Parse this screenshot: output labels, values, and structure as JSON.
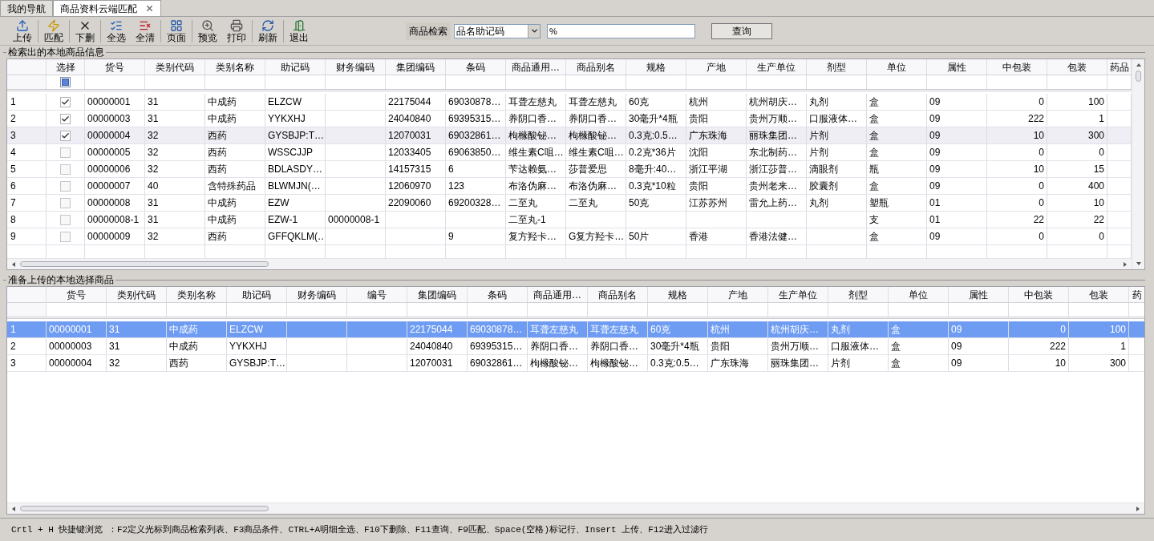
{
  "tabs": [
    {
      "label": "我的导航",
      "selected": false,
      "closable": false
    },
    {
      "label": "商品资料云端匹配",
      "selected": true,
      "closable": true
    }
  ],
  "toolbar": [
    {
      "label": "上传",
      "separator_after": true
    },
    {
      "label": "匹配",
      "separator_after": true
    },
    {
      "label": "下删",
      "separator_after": true
    },
    {
      "label": "全选",
      "separator_after": false
    },
    {
      "label": "全清",
      "separator_after": true
    },
    {
      "label": "页面",
      "separator_after": true
    },
    {
      "label": "预览",
      "separator_after": false
    },
    {
      "label": "打印",
      "separator_after": true
    },
    {
      "label": "刷新",
      "separator_after": true
    },
    {
      "label": "退出",
      "separator_after": false
    }
  ],
  "search": {
    "label": "商品检索",
    "field": "品名助记码",
    "value": "%",
    "button": "查询"
  },
  "local_goods": {
    "title": "检索出的本地商品信息",
    "check_column": "选择",
    "select_all_partial": true,
    "columns": [
      {
        "label": "货号",
        "kind": "text"
      },
      {
        "label": "类别代码",
        "kind": "text"
      },
      {
        "label": "类别名称",
        "kind": "text"
      },
      {
        "label": "助记码",
        "kind": "text"
      },
      {
        "label": "财务编码",
        "kind": "text"
      },
      {
        "label": "集团编码",
        "kind": "text"
      },
      {
        "label": "条码",
        "kind": "text"
      },
      {
        "label": "商品通用…",
        "kind": "text"
      },
      {
        "label": "商品别名",
        "kind": "text"
      },
      {
        "label": "规格",
        "kind": "text"
      },
      {
        "label": "产地",
        "kind": "text"
      },
      {
        "label": "生产单位",
        "kind": "text"
      },
      {
        "label": "剂型",
        "kind": "text"
      },
      {
        "label": "单位",
        "kind": "text"
      },
      {
        "label": "属性",
        "kind": "text"
      },
      {
        "label": "中包装",
        "kind": "number"
      },
      {
        "label": "包装",
        "kind": "number"
      },
      {
        "label": "药品",
        "kind": "text"
      }
    ],
    "rows": [
      {
        "no": "1",
        "checked": true,
        "selected": false,
        "cells": [
          "00000001",
          "31",
          "中成药",
          "ELZCW",
          null,
          "22175044",
          "69030878…",
          "耳聋左慈丸",
          "耳聋左慈丸",
          "60克",
          "杭州",
          "杭州胡庆…",
          "丸剂",
          "盒",
          "09",
          "0",
          "100"
        ]
      },
      {
        "no": "2",
        "checked": true,
        "selected": false,
        "cells": [
          "00000003",
          "31",
          "中成药",
          "YYKXHJ",
          null,
          "24040840",
          "69395315…",
          "养阴口香…",
          "养阴口香…",
          "30毫升*4瓶",
          "贵阳",
          "贵州万顺…",
          "口服液体…",
          "盒",
          "09",
          "222",
          "1"
        ]
      },
      {
        "no": "3",
        "checked": true,
        "selected": true,
        "cells": [
          "00000004",
          "32",
          "西药",
          "GYSBJP:T…",
          null,
          "12070031",
          "69032861…",
          "枸橼酸铋…",
          "枸橼酸铋…",
          "0.3克:0.5…",
          "广东珠海",
          "丽珠集团…",
          "片剂",
          "盒",
          "09",
          "10",
          "300"
        ]
      },
      {
        "no": "4",
        "checked": false,
        "selected": false,
        "cells": [
          "00000005",
          "32",
          "西药",
          "WSSCJJP",
          null,
          "12033405",
          "69063850…",
          "维生素C咀…",
          "维生素C咀…",
          "0.2克*36片",
          "沈阳",
          "东北制药…",
          "片剂",
          "盒",
          "09",
          "0",
          "0"
        ]
      },
      {
        "no": "5",
        "checked": false,
        "selected": false,
        "cells": [
          "00000006",
          "32",
          "西药",
          "BDLASDY…",
          null,
          "14157315",
          "6",
          "苄达赖氨…",
          "莎普爱思",
          "8毫升:40…",
          "浙江平湖",
          "浙江莎普…",
          "滴眼剂",
          "瓶",
          "09",
          "10",
          "15"
        ]
      },
      {
        "no": "6",
        "checked": false,
        "selected": false,
        "cells": [
          "00000007",
          "40",
          "含特殊药品",
          "BLWMJN(…",
          null,
          "12060970",
          "123",
          "布洛伪麻…",
          "布洛伪麻…",
          "0.3克*10粒",
          "贵阳",
          "贵州老来…",
          "胶囊剂",
          "盒",
          "09",
          "0",
          "400"
        ]
      },
      {
        "no": "7",
        "checked": false,
        "selected": false,
        "cells": [
          "00000008",
          "31",
          "中成药",
          "EZW",
          null,
          "22090060",
          "69200328…",
          "二至丸",
          "二至丸",
          "50克",
          "江苏苏州",
          "雷允上药…",
          "丸剂",
          "塑瓶",
          "01",
          "0",
          "10"
        ]
      },
      {
        "no": "8",
        "checked": false,
        "selected": false,
        "cells": [
          "00000008-1",
          "31",
          "中成药",
          "EZW-1",
          "00000008-1",
          null,
          null,
          "二至丸-1",
          null,
          null,
          null,
          null,
          null,
          "支",
          "01",
          "22",
          "22"
        ]
      },
      {
        "no": "9",
        "checked": false,
        "selected": false,
        "cells": [
          "00000009",
          "32",
          "西药",
          "GFFQKLM(…",
          null,
          null,
          "9",
          "复方羟卡…",
          "G复方羟卡…",
          "50片",
          "香港",
          "香港法健…",
          null,
          "盒",
          "09",
          "0",
          "0"
        ]
      }
    ]
  },
  "upload_goods": {
    "title": "准备上传的本地选择商品",
    "columns": [
      {
        "label": "货号",
        "kind": "text"
      },
      {
        "label": "类别代码",
        "kind": "text"
      },
      {
        "label": "类别名称",
        "kind": "text"
      },
      {
        "label": "助记码",
        "kind": "text"
      },
      {
        "label": "财务编码",
        "kind": "text"
      },
      {
        "label": "编号",
        "kind": "text"
      },
      {
        "label": "集团编码",
        "kind": "text"
      },
      {
        "label": "条码",
        "kind": "text"
      },
      {
        "label": "商品通用…",
        "kind": "text"
      },
      {
        "label": "商品别名",
        "kind": "text"
      },
      {
        "label": "规格",
        "kind": "text"
      },
      {
        "label": "产地",
        "kind": "text"
      },
      {
        "label": "生产单位",
        "kind": "text"
      },
      {
        "label": "剂型",
        "kind": "text"
      },
      {
        "label": "单位",
        "kind": "text"
      },
      {
        "label": "属性",
        "kind": "text"
      },
      {
        "label": "中包装",
        "kind": "number"
      },
      {
        "label": "包装",
        "kind": "number"
      },
      {
        "label": "药",
        "kind": "text"
      }
    ],
    "rows": [
      {
        "no": "1",
        "selected": true,
        "cells": [
          "00000001",
          "31",
          "中成药",
          "ELZCW",
          null,
          null,
          "22175044",
          "69030878…",
          "耳聋左慈丸",
          "耳聋左慈丸",
          "60克",
          "杭州",
          "杭州胡庆…",
          "丸剂",
          "盒",
          "09",
          "0",
          "100"
        ]
      },
      {
        "no": "2",
        "selected": false,
        "cells": [
          "00000003",
          "31",
          "中成药",
          "YYKXHJ",
          null,
          null,
          "24040840",
          "69395315…",
          "养阴口香…",
          "养阴口香…",
          "30毫升*4瓶",
          "贵阳",
          "贵州万顺…",
          "口服液体…",
          "盒",
          "09",
          "222",
          "1"
        ]
      },
      {
        "no": "3",
        "selected": false,
        "cells": [
          "00000004",
          "32",
          "西药",
          "GYSBJP:T…",
          null,
          null,
          "12070031",
          "69032861…",
          "枸橼酸铋…",
          "枸橼酸铋…",
          "0.3克:0.5…",
          "广东珠海",
          "丽珠集团…",
          "片剂",
          "盒",
          "09",
          "10",
          "300"
        ]
      }
    ]
  },
  "status_bar": "Crtl + H 快捷键浏览 ：F2定义光标到商品检索列表、F3商品条件、CTRL+A明细全选、F10下删除、F11查询、F9匹配、Space(空格)标记行、Insert 上传、F12进入过滤行"
}
